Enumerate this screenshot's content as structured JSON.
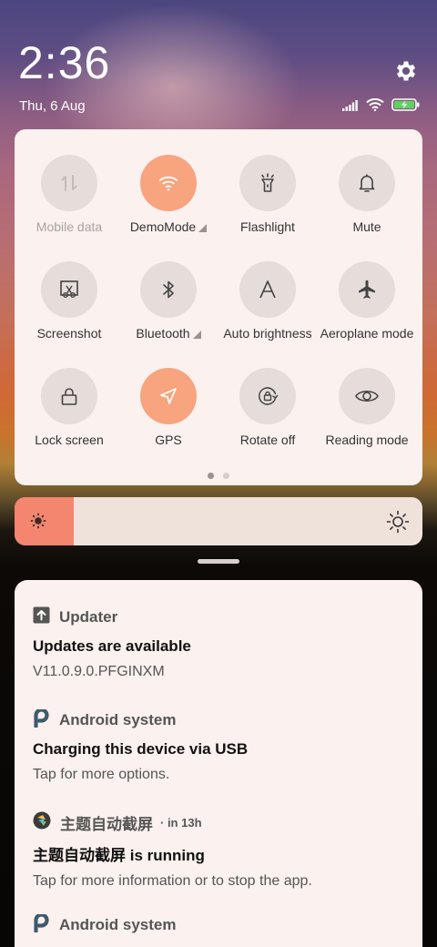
{
  "header": {
    "time": "2:36",
    "date": "Thu, 6 Aug",
    "settings_icon": "gear-icon",
    "status_icons": [
      "signal-icon",
      "wifi-icon",
      "battery-charging-icon"
    ]
  },
  "quick_settings": {
    "tiles": [
      {
        "label": "Mobile data",
        "icon": "mobile-data-icon",
        "active": false,
        "disabled": true
      },
      {
        "label": "DemoMode",
        "icon": "wifi-icon",
        "active": true,
        "expandable": true
      },
      {
        "label": "Flashlight",
        "icon": "flashlight-icon",
        "active": false
      },
      {
        "label": "Mute",
        "icon": "bell-icon",
        "active": false
      },
      {
        "label": "Screenshot",
        "icon": "screenshot-icon",
        "active": false
      },
      {
        "label": "Bluetooth",
        "icon": "bluetooth-icon",
        "active": false,
        "expandable": true
      },
      {
        "label": "Auto brightness",
        "icon": "auto-brightness-icon",
        "active": false
      },
      {
        "label": "Aeroplane mode",
        "icon": "airplane-icon",
        "active": false
      },
      {
        "label": "Lock screen",
        "icon": "lock-icon",
        "active": false
      },
      {
        "label": "GPS",
        "icon": "location-icon",
        "active": true
      },
      {
        "label": "Rotate off",
        "icon": "rotate-lock-icon",
        "active": false
      },
      {
        "label": "Reading mode",
        "icon": "eye-icon",
        "active": false
      }
    ],
    "page_indicator": {
      "pages": 2,
      "current": 1
    }
  },
  "brightness": {
    "level": 0.145
  },
  "colors": {
    "accent": "#f7a47f",
    "slider_fill": "#f4856f",
    "panel": "#fbf1ee"
  },
  "notifications": [
    {
      "app": "Updater",
      "icon": "updater-icon",
      "time": "",
      "title": "Updates are available",
      "body": "V11.0.9.0.PFGINXM"
    },
    {
      "app": "Android system",
      "icon": "android-system-icon",
      "time": "",
      "title": "Charging this device via USB",
      "body": "Tap for more options."
    },
    {
      "app": "主题自动截屏",
      "icon": "app-icon",
      "time": "· in 13h",
      "title": "主题自动截屏 is running",
      "body": "Tap for more information or to stop the app."
    },
    {
      "app": "Android system",
      "icon": "android-system-icon",
      "time": "",
      "title": "",
      "body": ""
    }
  ]
}
